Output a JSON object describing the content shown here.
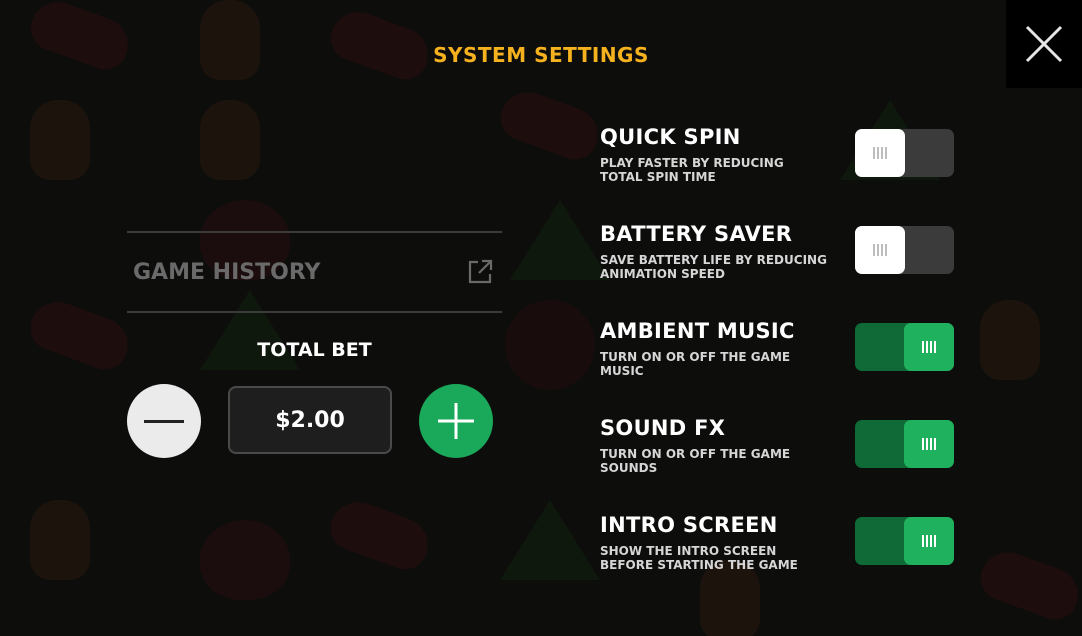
{
  "header": {
    "title": "SYSTEM SETTINGS",
    "close_icon": "close-icon"
  },
  "history": {
    "label": "GAME HISTORY",
    "icon": "external-link-icon"
  },
  "bet": {
    "label": "TOTAL BET",
    "value": "$2.00",
    "minus_icon": "minus-icon",
    "plus_icon": "plus-icon"
  },
  "settings": [
    {
      "name": "QUICK SPIN",
      "description": "PLAY FASTER BY REDUCING TOTAL SPIN TIME",
      "enabled": false
    },
    {
      "name": "BATTERY SAVER",
      "description": "SAVE BATTERY LIFE BY REDUCING ANIMATION SPEED",
      "enabled": false
    },
    {
      "name": "AMBIENT MUSIC",
      "description": "TURN ON OR OFF THE GAME MUSIC",
      "enabled": true
    },
    {
      "name": "SOUND FX",
      "description": "TURN ON OR OFF THE GAME SOUNDS",
      "enabled": true
    },
    {
      "name": "INTRO SCREEN",
      "description": "SHOW THE INTRO SCREEN BEFORE STARTING THE GAME",
      "enabled": true
    }
  ],
  "colors": {
    "title": "#f6b21e",
    "toggle_on": "#1fb15e",
    "toggle_on_track": "#0f6a38",
    "toggle_off_track": "#3b3b3b",
    "plus_button": "#1aa95a"
  }
}
